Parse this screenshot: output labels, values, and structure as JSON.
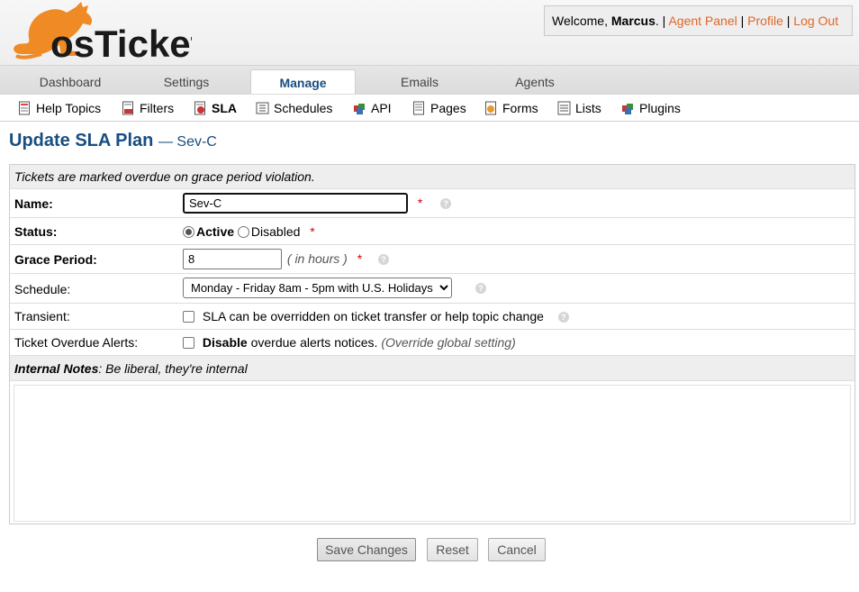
{
  "brand": {
    "logo_text": "osTicket",
    "accent": "#f08a24"
  },
  "header": {
    "welcome_prefix": "Welcome,",
    "user_name": "Marcus",
    "sep": ". |",
    "agent_panel": "Agent Panel",
    "profile": "Profile",
    "logout": "Log Out"
  },
  "tabs": [
    {
      "label": "Dashboard"
    },
    {
      "label": "Settings"
    },
    {
      "label": "Manage",
      "active": true
    },
    {
      "label": "Emails"
    },
    {
      "label": "Agents"
    }
  ],
  "subnav": [
    {
      "label": "Help Topics",
      "icon": "help-topics-icon"
    },
    {
      "label": "Filters",
      "icon": "filters-icon"
    },
    {
      "label": "SLA",
      "icon": "sla-icon",
      "active": true
    },
    {
      "label": "Schedules",
      "icon": "schedules-icon"
    },
    {
      "label": "API",
      "icon": "api-icon"
    },
    {
      "label": "Pages",
      "icon": "pages-icon"
    },
    {
      "label": "Forms",
      "icon": "forms-icon"
    },
    {
      "label": "Lists",
      "icon": "lists-icon"
    },
    {
      "label": "Plugins",
      "icon": "plugins-icon"
    }
  ],
  "page": {
    "title": "Update SLA Plan",
    "subtitle": "— Sev-C"
  },
  "form": {
    "notice": "Tickets are marked overdue on grace period violation.",
    "name_label": "Name:",
    "name_value": "Sev-C",
    "status_label": "Status:",
    "status_active": "Active",
    "status_disabled": "Disabled",
    "grace_label": "Grace Period:",
    "grace_value": "8",
    "grace_unit": "( in hours )",
    "schedule_label": "Schedule:",
    "schedule_value": "Monday - Friday 8am - 5pm with U.S. Holidays",
    "transient_label": "Transient:",
    "transient_text": "SLA can be overridden on ticket transfer or help topic change",
    "overdue_label": "Ticket Overdue Alerts:",
    "overdue_bold": "Disable",
    "overdue_text": "overdue alerts notices.",
    "overdue_note": "(Override global setting)",
    "notes_title": "Internal Notes",
    "notes_hint": ": Be liberal, they're internal",
    "required_mark": "*",
    "help_mark": "?"
  },
  "buttons": {
    "save": "Save Changes",
    "reset": "Reset",
    "cancel": "Cancel"
  }
}
